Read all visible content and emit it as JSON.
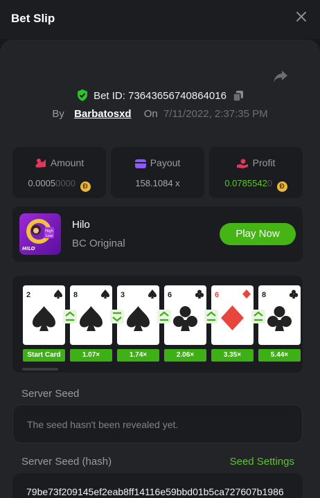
{
  "header": {
    "title": "Bet Slip"
  },
  "bet": {
    "id_text": "Bet ID: 73643656740864016",
    "by_label": "By",
    "user": "Barbatosxd",
    "on_label": "On",
    "date": "7/11/2022, 2:37:35 PM"
  },
  "stats": {
    "amount": {
      "label": "Amount",
      "value_main": "0.0005",
      "value_dim": "0000",
      "coin": "Đ"
    },
    "payout": {
      "label": "Payout",
      "value": "158.1084 x"
    },
    "profit": {
      "label": "Profit",
      "value_main": "0.0785542",
      "value_dim": "0",
      "coin": "Đ"
    }
  },
  "game": {
    "name": "Hilo",
    "subtitle": "BC Original",
    "play_label": "Play Now",
    "thumb_text": "HILO",
    "thumb_high": "High",
    "thumb_low": "Low"
  },
  "cards": [
    {
      "rank": "2",
      "suit": "spade",
      "mult": "Start Card"
    },
    {
      "rank": "8",
      "suit": "spade",
      "mult": "1.07×",
      "guess": "higher"
    },
    {
      "rank": "3",
      "suit": "spade",
      "mult": "1.74×",
      "guess": "lower"
    },
    {
      "rank": "6",
      "suit": "club",
      "mult": "2.06×",
      "guess": "higher"
    },
    {
      "rank": "6",
      "suit": "diamond",
      "mult": "3.35×",
      "guess": "higher"
    },
    {
      "rank": "8",
      "suit": "club",
      "mult": "5.44×",
      "guess": "higher"
    }
  ],
  "server_seed": {
    "label": "Server Seed",
    "value": "The seed hasn't been revealed yet."
  },
  "server_seed_hash": {
    "label": "Server Seed (hash)",
    "settings_label": "Seed Settings",
    "value": "79be73f209145ef2eab8ff14116e59bbd01b5ca727607b1986"
  },
  "colors": {
    "accent_green": "#44b515",
    "coin": "#e9b740",
    "panel": "#232427"
  }
}
